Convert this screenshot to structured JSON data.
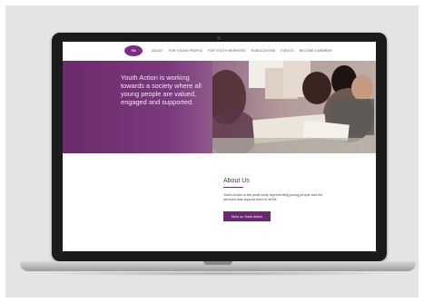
{
  "logo": {
    "text": "YA"
  },
  "nav": {
    "items": [
      "About",
      "For young people",
      "For youth workers",
      "Publications",
      "Events",
      "Become a member"
    ]
  },
  "hero": {
    "tagline": "Youth Action is working towards a society where all young people are valued, engaged and supported."
  },
  "about": {
    "title": "About Us",
    "body": "Youth Action is the peak body representing young people and the services that support them in NSW.",
    "button_label": "More on Youth Action"
  },
  "colors": {
    "brand": "#7a2d82",
    "button": "#6a2870"
  }
}
